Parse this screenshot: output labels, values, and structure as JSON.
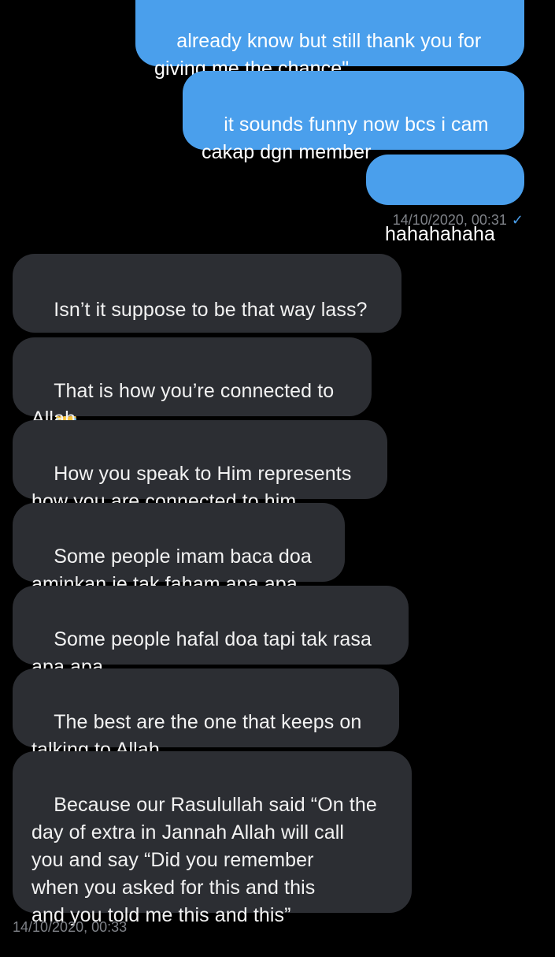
{
  "colors": {
    "sent_bubble": "#4a9fec",
    "received_bubble": "#2c2e33",
    "background": "#000000",
    "timestamp": "#7f8288",
    "read_check": "#4a9fec"
  },
  "sent_messages": [
    {
      "text": "already know but still thank you for\ngiving me the chance\""
    },
    {
      "text": "it sounds funny now bcs i cam\ncakap dgn member"
    },
    {
      "text": "hahahahaha"
    }
  ],
  "sent_timestamp": "14/10/2020, 00:31",
  "sent_status_icon": "read-check-icon",
  "received_messages": [
    {
      "text": "Isn’t it suppose to be that way lass?"
    },
    {
      "text": "That is how you’re connected to\nAllah"
    },
    {
      "text": "How you speak to Him represents\nhow you are connected to him."
    },
    {
      "text": "Some people imam baca doa\naminkan je tak faham apa apa."
    },
    {
      "text": "Some people hafal doa tapi tak rasa\napa apa."
    },
    {
      "text": "The best are the one that keeps on\ntalking to Allah."
    },
    {
      "text": "Because our Rasulullah said “On the\nday of extra in Jannah Allah will call\nyou and say “Did you remember\nwhen you asked for this and this\nand you told me this and this”"
    }
  ],
  "received_emoji": "laughing-tears-emoji",
  "received_timestamp": "14/10/2020, 00:33"
}
